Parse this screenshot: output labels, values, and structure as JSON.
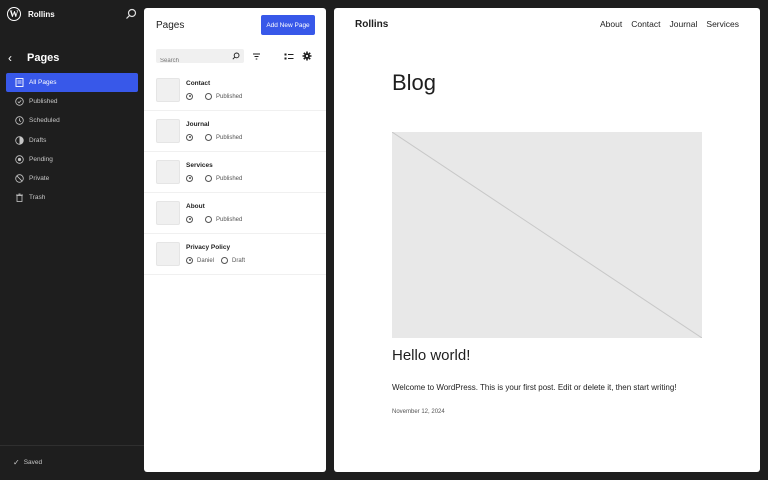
{
  "sidebar": {
    "site_name": "Rollins",
    "title": "Pages",
    "items": [
      {
        "label": "All Pages",
        "icon": "pages-icon"
      },
      {
        "label": "Published",
        "icon": "published-icon"
      },
      {
        "label": "Scheduled",
        "icon": "scheduled-icon"
      },
      {
        "label": "Drafts",
        "icon": "drafts-icon"
      },
      {
        "label": "Pending",
        "icon": "pending-icon"
      },
      {
        "label": "Private",
        "icon": "private-icon"
      },
      {
        "label": "Trash",
        "icon": "trash-icon"
      }
    ],
    "saved_label": "Saved"
  },
  "panel": {
    "title": "Pages",
    "add_button": "Add New Page",
    "search_placeholder": "Search",
    "rows": [
      {
        "title": "Contact",
        "author": "",
        "status": "Published"
      },
      {
        "title": "Journal",
        "author": "",
        "status": "Published"
      },
      {
        "title": "Services",
        "author": "",
        "status": "Published"
      },
      {
        "title": "About",
        "author": "",
        "status": "Published"
      },
      {
        "title": "Privacy Policy",
        "author": "Daniel",
        "status": "Draft"
      }
    ]
  },
  "preview": {
    "site_title": "Rollins",
    "nav": [
      "About",
      "Contact",
      "Journal",
      "Services"
    ],
    "heading": "Blog",
    "post_title": "Hello world!",
    "excerpt": "Welcome to WordPress. This is your first post. Edit or delete it, then start writing!",
    "date": "November 12, 2024"
  },
  "colors": {
    "accent": "#3858e9",
    "sidebar_bg": "#1e1e1e"
  }
}
